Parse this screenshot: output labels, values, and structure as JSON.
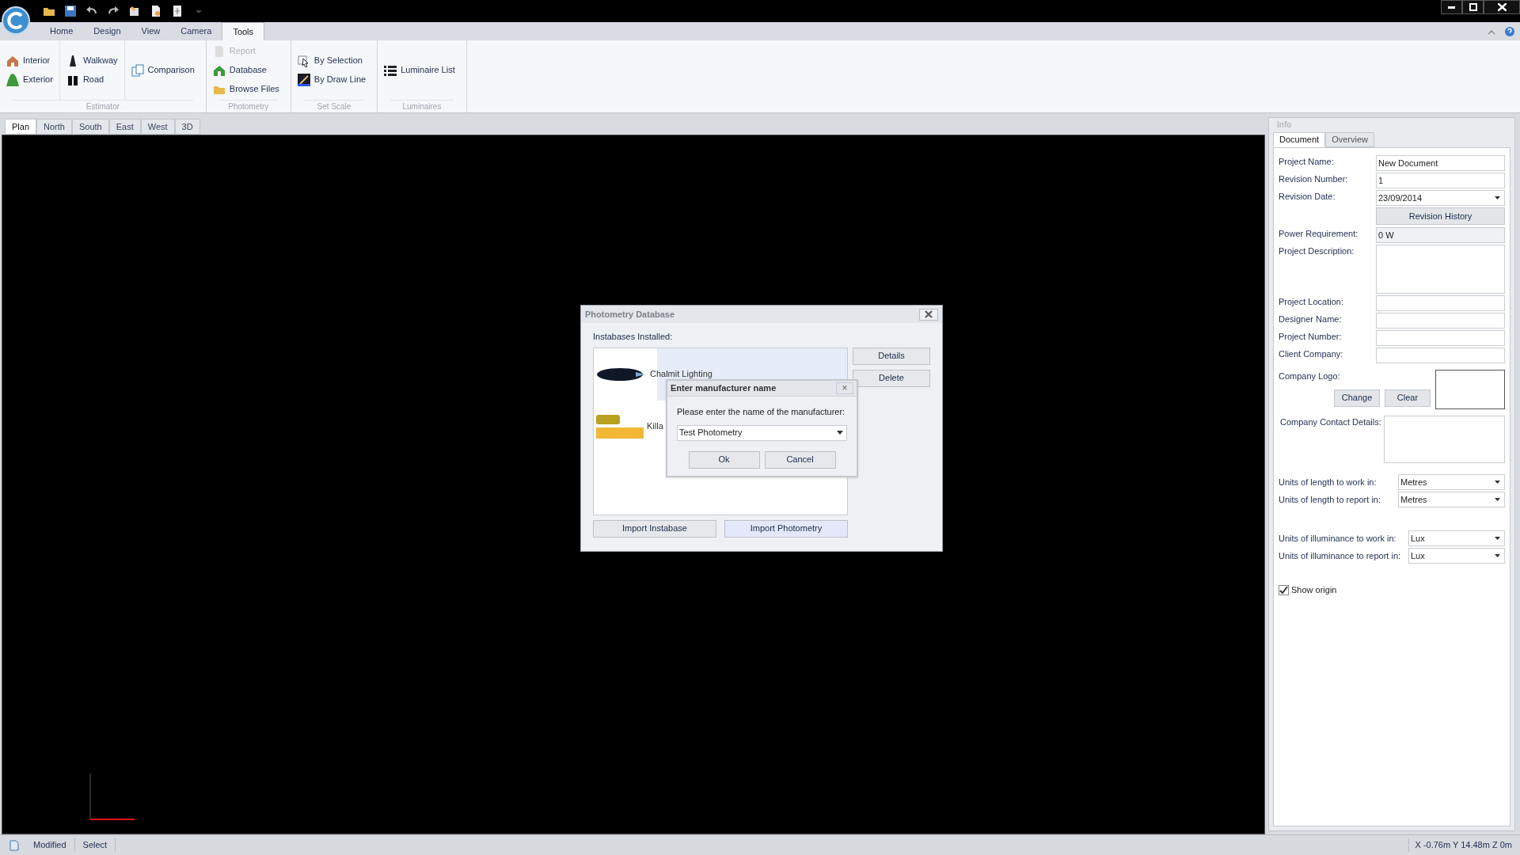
{
  "ribbon": {
    "tabs": [
      {
        "label": "Home",
        "selected": false
      },
      {
        "label": "Design",
        "selected": false
      },
      {
        "label": "View",
        "selected": false
      },
      {
        "label": "Camera",
        "selected": false
      },
      {
        "label": "Tools",
        "selected": true
      }
    ],
    "groups": [
      {
        "label": "Estimator",
        "columns": [
          [
            {
              "label": "Interior",
              "disabled": false
            },
            {
              "label": "Exterior",
              "disabled": false
            }
          ],
          [
            {
              "label": "Walkway",
              "disabled": false
            },
            {
              "label": "Road",
              "disabled": false
            }
          ],
          [
            {
              "label": "Comparison",
              "disabled": false
            }
          ]
        ]
      },
      {
        "label": "Photometry",
        "columns": [
          [
            {
              "label": "Report",
              "disabled": true
            },
            {
              "label": "Database",
              "disabled": false
            },
            {
              "label": "Browse Files",
              "disabled": false
            }
          ]
        ]
      },
      {
        "label": "Set Scale",
        "columns": [
          [
            {
              "label": "By Selection",
              "disabled": false
            },
            {
              "label": "By Draw Line",
              "disabled": false
            }
          ]
        ]
      },
      {
        "label": "Luminaires",
        "columns": [
          [
            {
              "label": "Luminaire List",
              "disabled": false
            }
          ]
        ]
      }
    ]
  },
  "view_tabs": [
    {
      "label": "Plan",
      "selected": true
    },
    {
      "label": "North",
      "selected": false
    },
    {
      "label": "South",
      "selected": false
    },
    {
      "label": "East",
      "selected": false
    },
    {
      "label": "West",
      "selected": false
    },
    {
      "label": "3D",
      "selected": false
    }
  ],
  "dialog": {
    "title": "Photometry Database",
    "list_label": "Instabases Installed:",
    "instabases": [
      {
        "name": "Chalmit Lighting",
        "selected": true
      },
      {
        "name": "Killa",
        "selected": false
      }
    ],
    "side_buttons": [
      "Details",
      "Delete"
    ],
    "bottom_buttons": [
      {
        "label": "Import Instabase",
        "focused": false
      },
      {
        "label": "Import Photometry",
        "focused": true
      }
    ],
    "prompt": {
      "title": "Enter manufacturer name",
      "close": "×",
      "message": "Please enter the name of the manufacturer:",
      "value": "Test Photometry",
      "buttons": [
        "Ok",
        "Cancel"
      ]
    }
  },
  "info": {
    "title": "Info",
    "tabs": [
      {
        "label": "Document",
        "selected": true
      },
      {
        "label": "Overview",
        "selected": false
      }
    ],
    "fields": [
      {
        "kind": "text",
        "label": "Project Name:",
        "value": "New Document"
      },
      {
        "kind": "text",
        "label": "Revision Number:",
        "value": "1"
      },
      {
        "kind": "dropdown",
        "label": "Revision Date:",
        "value": "23/09/2014"
      },
      {
        "kind": "button",
        "label": "Revision History"
      },
      {
        "kind": "readonly",
        "label": "Power Requirement:",
        "value": "0 W"
      },
      {
        "kind": "textarea",
        "label": "Project Description:"
      },
      {
        "kind": "text",
        "label": "Project Location:"
      },
      {
        "kind": "text",
        "label": "Designer Name:"
      },
      {
        "kind": "text",
        "label": "Project Number:"
      },
      {
        "kind": "text",
        "label": "Client Company:"
      },
      {
        "kind": "logo",
        "label": "Company Logo:",
        "buttons": [
          "Change",
          "Clear"
        ]
      },
      {
        "kind": "contact",
        "label": "Company Contact Details:"
      }
    ],
    "unit_groups": [
      [
        {
          "label": "Units of length to work in:",
          "value": "Metres"
        },
        {
          "label": "Units of length to report in:",
          "value": "Metres"
        }
      ],
      [
        {
          "label": "Units of illuminance to work in:",
          "value": "Lux"
        },
        {
          "label": "Units of illuminance to report in:",
          "value": "Lux"
        }
      ]
    ],
    "show_origin": {
      "label": "Show origin",
      "checked": true
    }
  },
  "status_bar": {
    "items": [
      "Modified",
      "Select"
    ],
    "coordinates": "X -0.76m Y 14.48m Z 0m"
  }
}
